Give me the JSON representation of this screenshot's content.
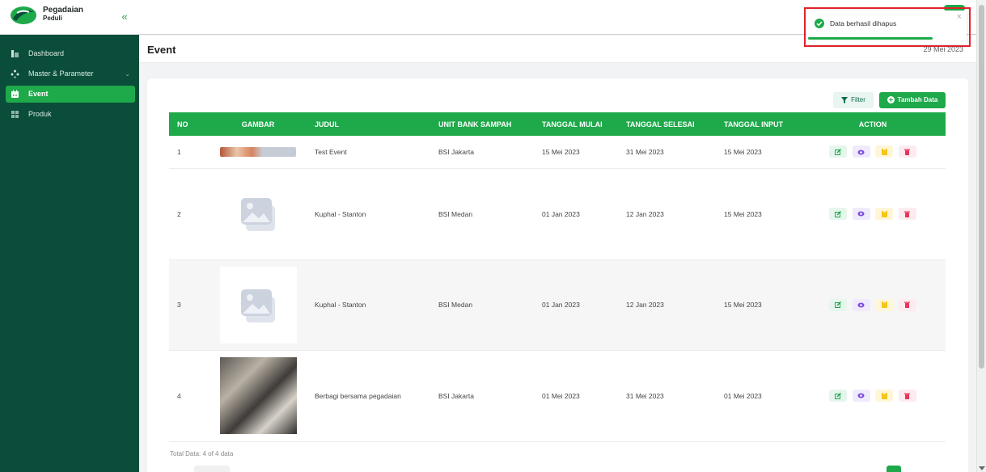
{
  "brand": {
    "title": "Pegadaian",
    "subtitle": "Peduli",
    "collapse_glyph": "«"
  },
  "sidebar": {
    "items": [
      {
        "label": "Dashboard",
        "icon": "chart-bar-icon"
      },
      {
        "label": "Master & Parameter",
        "icon": "database-icon",
        "chevron": "⌄"
      },
      {
        "label": "Event",
        "icon": "calendar-icon",
        "active": true
      },
      {
        "label": "Produk",
        "icon": "grid-icon"
      }
    ]
  },
  "header": {
    "title": "Event",
    "date": "29 Mei 2023"
  },
  "toolbar": {
    "filter_label": "Filter",
    "add_label": "Tambah Data"
  },
  "table": {
    "columns": [
      "NO",
      "GAMBAR",
      "JUDUL",
      "UNIT BANK SAMPAH",
      "TANGGAL MULAI",
      "TANGGAL SELESAI",
      "TANGGAL INPUT",
      "ACTION"
    ],
    "rows": [
      {
        "no": "1",
        "image": "banner-image",
        "judul": "Test Event",
        "unit": "BSI Jakarta",
        "mulai": "15 Mei 2023",
        "selesai": "31 Mei 2023",
        "input": "15 Mei 2023"
      },
      {
        "no": "2",
        "image": "image-placeholder-icon",
        "judul": "Kuphal - Stanton",
        "unit": "BSI Medan",
        "mulai": "01 Jan 2023",
        "selesai": "12 Jan 2023",
        "input": "15 Mei 2023"
      },
      {
        "no": "3",
        "image": "image-placeholder-icon",
        "judul": "Kuphal - Stanton",
        "unit": "BSI Medan",
        "mulai": "01 Jan 2023",
        "selesai": "12 Jan 2023",
        "input": "15 Mei 2023"
      },
      {
        "no": "4",
        "image": "event-photo",
        "judul": "Berbagi bersama pegadaian",
        "unit": "BSI Jakarta",
        "mulai": "01 Mei 2023",
        "selesai": "31 Mei 2023",
        "input": "01 Mei 2023"
      }
    ],
    "actions": [
      "edit-icon",
      "eye-icon",
      "copy-icon",
      "trash-icon"
    ]
  },
  "footer": {
    "total": "Total Data: 4 of 4 data"
  },
  "toast": {
    "message": "Data berhasil dihapus",
    "icon": "check-circle-icon",
    "close_glyph": "×"
  },
  "colors": {
    "sidebar": "#0a4d3a",
    "accent": "#1ea94a",
    "highlight": "#e0232a"
  }
}
